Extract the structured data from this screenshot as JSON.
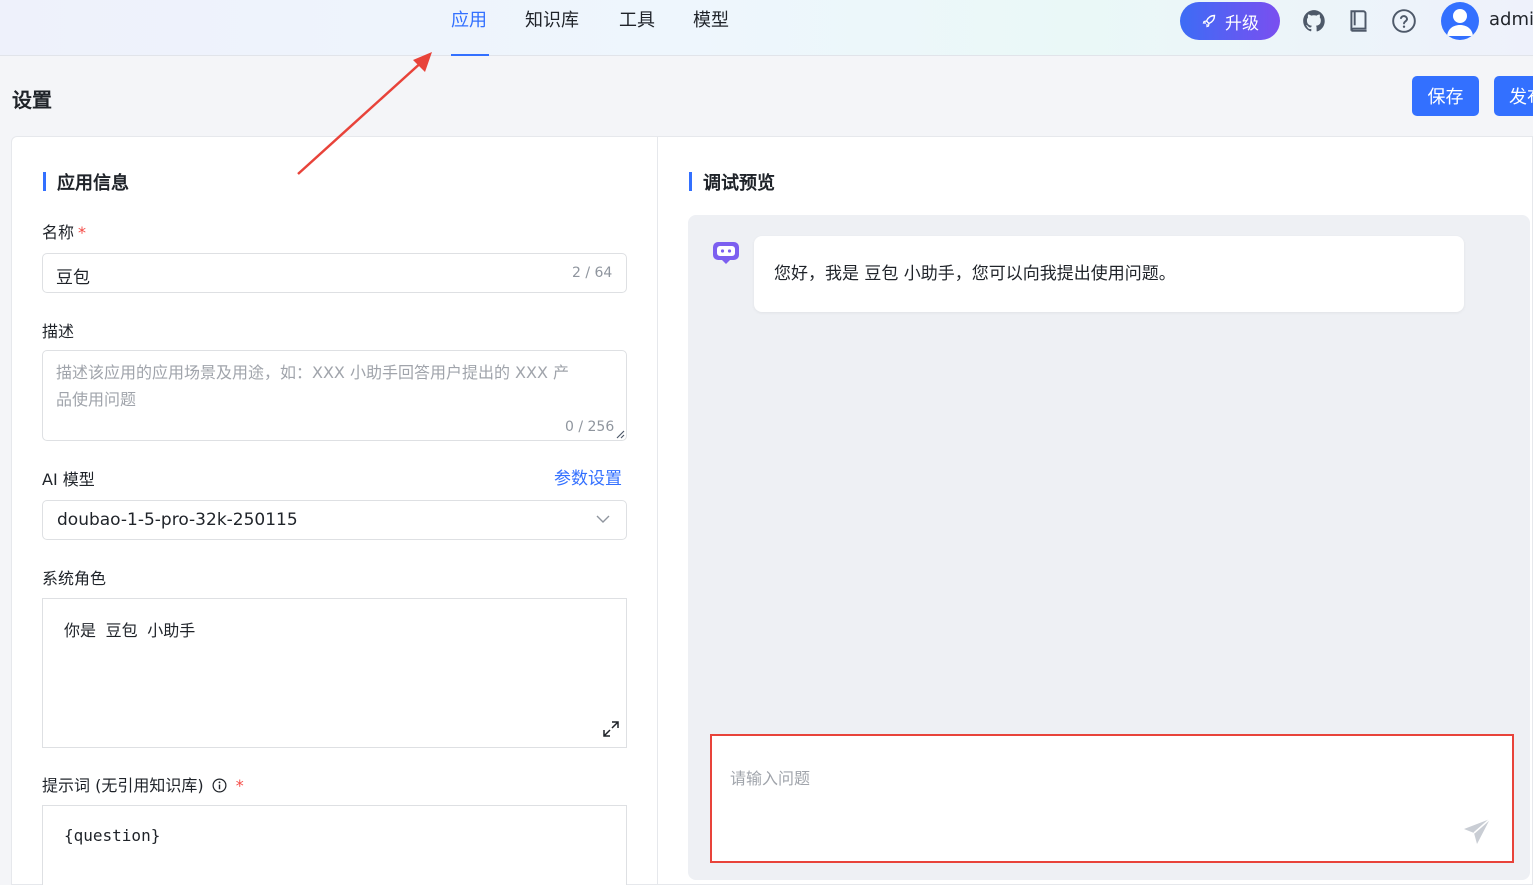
{
  "nav": {
    "tabs": [
      {
        "label": "应用",
        "active": true
      },
      {
        "label": "知识库"
      },
      {
        "label": "工具"
      },
      {
        "label": "模型"
      }
    ],
    "upgrade_label": "升级",
    "icons": [
      "github-icon",
      "book-icon",
      "help-icon"
    ],
    "username": "admi"
  },
  "page": {
    "title": "设置",
    "save_label": "保存",
    "publish_label": "发布"
  },
  "app_info": {
    "section_title": "应用信息",
    "name_label": "名称",
    "name_value": "豆包",
    "name_counter": "2 / 64",
    "desc_label": "描述",
    "desc_placeholder_line1": "描述该应用的应用场景及用途，如：XXX 小助手回答用户提出的 XXX 产",
    "desc_placeholder_line2": "品使用问题",
    "desc_counter": "0 / 256",
    "model_label": "AI 模型",
    "model_settings_link": "参数设置",
    "model_value": "doubao-1-5-pro-32k-250115",
    "role_label": "系统角色",
    "role_value": "你是 豆包 小助手",
    "prompt_label": "提示词 (无引用知识库)",
    "prompt_value": "{question}"
  },
  "preview": {
    "section_title": "调试预览",
    "greeting": "您好，我是 豆包 小助手，您可以向我提出使用问题。",
    "input_placeholder": "请输入问题"
  },
  "colors": {
    "accent": "#3370ff",
    "annotation": "#e8433a",
    "required": "#f54a45"
  }
}
